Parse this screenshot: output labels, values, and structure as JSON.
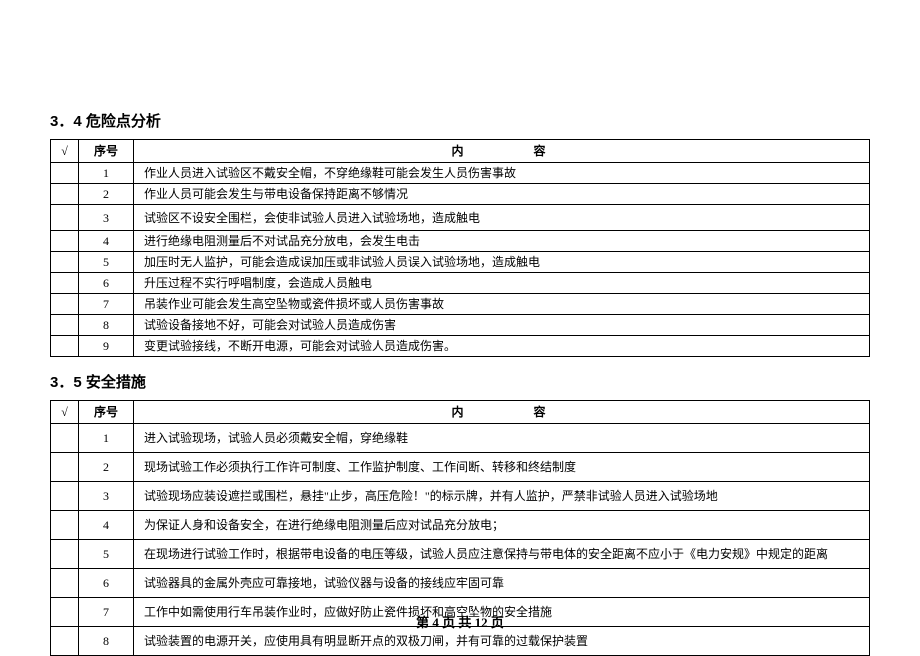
{
  "section1": {
    "title": "3．4 危险点分析",
    "headers": [
      "√",
      "序号",
      "内容"
    ],
    "rows": [
      {
        "num": "1",
        "content": "作业人员进入试验区不戴安全帽，不穿绝缘鞋可能会发生人员伤害事故"
      },
      {
        "num": "2",
        "content": "作业人员可能会发生与带电设备保持距离不够情况"
      },
      {
        "num": "3",
        "content": "试验区不设安全围栏，会使非试验人员进入试验场地，造成触电"
      },
      {
        "num": "4",
        "content": "进行绝缘电阻测量后不对试品充分放电，会发生电击"
      },
      {
        "num": "5",
        "content": "加压时无人监护，可能会造成误加压或非试验人员误入试验场地，造成触电"
      },
      {
        "num": "6",
        "content": "升压过程不实行呼唱制度，会造成人员触电"
      },
      {
        "num": "7",
        "content": "吊装作业可能会发生高空坠物或瓷件损坏或人员伤害事故"
      },
      {
        "num": "8",
        "content": "试验设备接地不好，可能会对试验人员造成伤害"
      },
      {
        "num": "9",
        "content": "变更试验接线，不断开电源，可能会对试验人员造成伤害。"
      }
    ]
  },
  "section2": {
    "title": "3．5 安全措施",
    "headers": [
      "√",
      "序号",
      "内容"
    ],
    "rows": [
      {
        "num": "1",
        "content": "进入试验现场，试验人员必须戴安全帽，穿绝缘鞋"
      },
      {
        "num": "2",
        "content": "现场试验工作必须执行工作许可制度、工作监护制度、工作间断、转移和终结制度"
      },
      {
        "num": "3",
        "content": "试验现场应装设遮拦或围栏，悬挂\"止步，高压危险！\"的标示牌，并有人监护，严禁非试验人员进入试验场地"
      },
      {
        "num": "4",
        "content": "为保证人身和设备安全，在进行绝缘电阻测量后应对试品充分放电；"
      },
      {
        "num": "5",
        "content": "在现场进行试验工作时，根据带电设备的电压等级，试验人员应注意保持与带电体的安全距离不应小于《电力安规》中规定的距离"
      },
      {
        "num": "6",
        "content": "试验器具的金属外壳应可靠接地，试验仪器与设备的接线应牢固可靠"
      },
      {
        "num": "7",
        "content": "工作中如需使用行车吊装作业时，应做好防止瓷件损坏和高空坠物的安全措施"
      },
      {
        "num": "8",
        "content": "试验装置的电源开关，应使用具有明显断开点的双极刀闸，并有可靠的过载保护装置"
      }
    ]
  },
  "footer": {
    "text": "第 4 页 共 12 页"
  }
}
